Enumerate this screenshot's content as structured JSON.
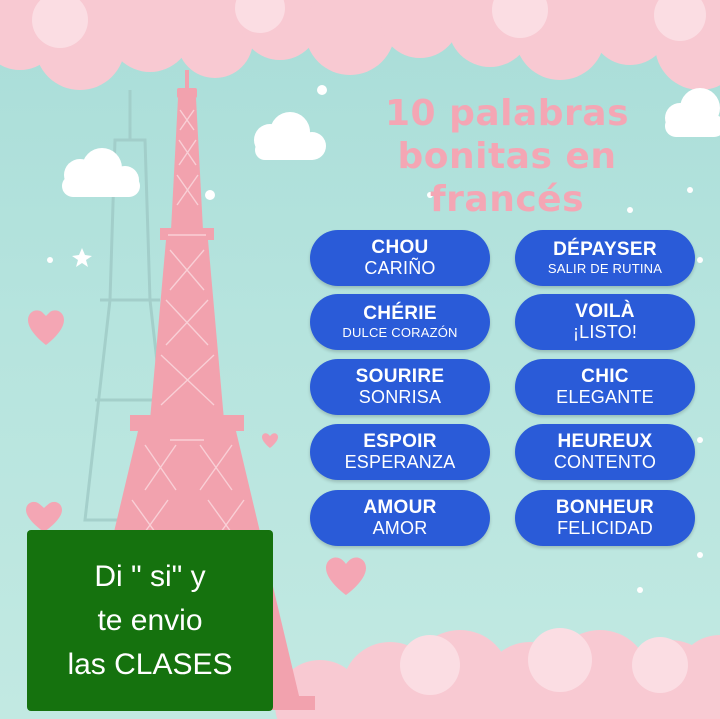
{
  "title": {
    "line1": "10 palabras",
    "line2": "bonitas en",
    "line3": "francés"
  },
  "words": [
    {
      "fr": "CHOU",
      "es": "CARIÑO"
    },
    {
      "fr": "CHÉRIE",
      "es": "DULCE CORAZÓN"
    },
    {
      "fr": "SOURIRE",
      "es": "SONRISA"
    },
    {
      "fr": "ESPOIR",
      "es": "ESPERANZA"
    },
    {
      "fr": "AMOUR",
      "es": "AMOR"
    },
    {
      "fr": "DÉPAYSER",
      "es": "SALIR DE RUTINA"
    },
    {
      "fr": "VOILÀ",
      "es": "¡LISTO!"
    },
    {
      "fr": "CHIC",
      "es": "ELEGANTE"
    },
    {
      "fr": "HEUREUX",
      "es": "CONTENTO"
    },
    {
      "fr": "BONHEUR",
      "es": "FELICIDAD"
    }
  ],
  "cta": {
    "line1": "Di \" si\" y",
    "line2": "te envio",
    "line3": "las CLASES"
  },
  "colors": {
    "background": "#b6e4de",
    "pill": "#2a5bd8",
    "title": "#f4a6b4",
    "cta": "#15720e",
    "tower": "#f2a2ae"
  },
  "icons": [
    "eiffel-tower-icon",
    "heart-icon",
    "cloud-icon",
    "star-icon"
  ]
}
